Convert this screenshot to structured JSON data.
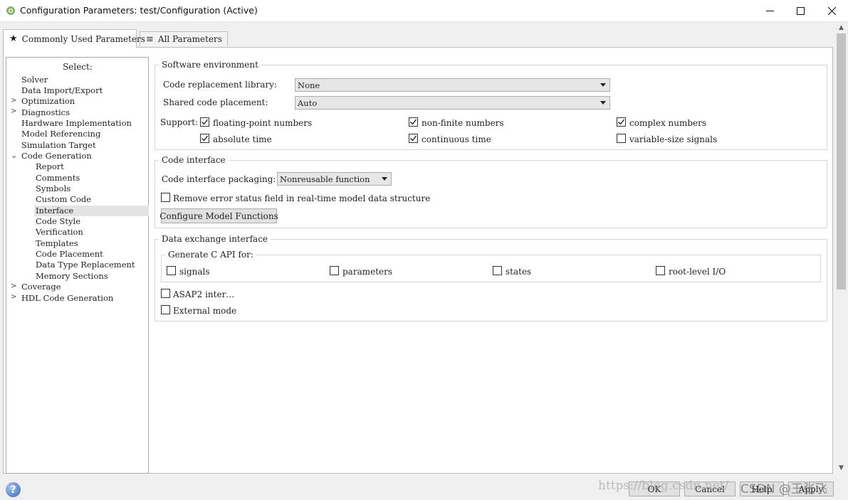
{
  "window": {
    "title": "Configuration Parameters: test/Configuration (Active)",
    "controls": [
      "minimize-icon",
      "maximize-icon",
      "close-icon"
    ]
  },
  "tabs": [
    {
      "label": "Commonly Used Parameters",
      "icon": "star-icon",
      "active": true
    },
    {
      "label": "All Parameters",
      "icon": "list-icon",
      "active": false
    }
  ],
  "tree": {
    "title": "Select:",
    "items": [
      {
        "label": "Solver",
        "expandable": false
      },
      {
        "label": "Data Import/Export",
        "expandable": false
      },
      {
        "label": "Optimization",
        "expandable": true,
        "expanded": false
      },
      {
        "label": "Diagnostics",
        "expandable": true,
        "expanded": false
      },
      {
        "label": "Hardware Implementation",
        "expandable": false
      },
      {
        "label": "Model Referencing",
        "expandable": false
      },
      {
        "label": "Simulation Target",
        "expandable": false
      },
      {
        "label": "Code Generation",
        "expandable": true,
        "expanded": true
      },
      {
        "label": "Report",
        "child": true
      },
      {
        "label": "Comments",
        "child": true
      },
      {
        "label": "Symbols",
        "child": true
      },
      {
        "label": "Custom Code",
        "child": true
      },
      {
        "label": "Interface",
        "child": true,
        "selected": true
      },
      {
        "label": "Code Style",
        "child": true
      },
      {
        "label": "Verification",
        "child": true
      },
      {
        "label": "Templates",
        "child": true
      },
      {
        "label": "Code Placement",
        "child": true
      },
      {
        "label": "Data Type Replacement",
        "child": true
      },
      {
        "label": "Memory Sections",
        "child": true
      },
      {
        "label": "Coverage",
        "expandable": true,
        "expanded": false
      },
      {
        "label": "HDL Code Generation",
        "expandable": true,
        "expanded": false
      }
    ]
  },
  "software_env": {
    "title": "Software environment",
    "code_replacement_label": "Code replacement library:",
    "code_replacement_value": "None",
    "shared_code_label": "Shared code placement:",
    "shared_code_value": "Auto",
    "support_label": "Support:",
    "support": [
      {
        "label": "floating-point numbers",
        "checked": true
      },
      {
        "label": "non-finite numbers",
        "checked": true
      },
      {
        "label": "complex numbers",
        "checked": true
      },
      {
        "label": "absolute time",
        "checked": true
      },
      {
        "label": "continuous time",
        "checked": true
      },
      {
        "label": "variable-size signals",
        "checked": false
      }
    ]
  },
  "code_interface": {
    "title": "Code interface",
    "packaging_label": "Code interface packaging:",
    "packaging_value": "Nonreusable function",
    "remove_error_label": "Remove error status field in real-time model data structure",
    "remove_error_checked": false,
    "configure_button": "Configure Model Functions"
  },
  "data_exchange": {
    "title": "Data exchange interface",
    "c_api_title": "Generate C API for:",
    "c_api": [
      {
        "label": "signals",
        "checked": false
      },
      {
        "label": "parameters",
        "checked": false
      },
      {
        "label": "states",
        "checked": false
      },
      {
        "label": "root-level I/O",
        "checked": false
      }
    ],
    "asap2_label": "ASAP2 inter…",
    "asap2_checked": false,
    "external_mode_label": "External mode",
    "external_mode_checked": false
  },
  "bottom": {
    "help_icon": "help-icon",
    "ok": "OK",
    "cancel": "Cancel",
    "help": "Help",
    "apply": "Apply",
    "watermark_url": "https://blog.csdn.net/",
    "watermark_brand": "CSDN @王张飞"
  }
}
